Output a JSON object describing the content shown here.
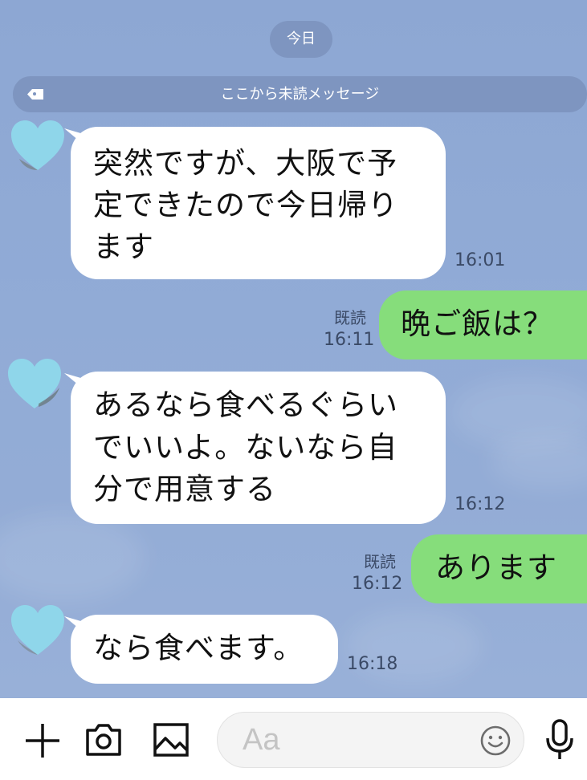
{
  "date_label": "今日",
  "unread_label": "ここから未読メッセージ",
  "messages": [
    {
      "dir": "in",
      "lines": [
        "突然ですが、大阪で予",
        "定できたので今日帰り",
        "ます"
      ],
      "time": "16:01"
    },
    {
      "dir": "out",
      "lines": [
        "晩ご飯は？"
      ],
      "read": "既読",
      "time": "16:11"
    },
    {
      "dir": "in",
      "lines": [
        "あるなら食べるぐらい",
        "でいいよ。ないなら自",
        "分で用意する"
      ],
      "time": "16:12"
    },
    {
      "dir": "out",
      "lines": [
        "あります"
      ],
      "read": "既読",
      "time": "16:12"
    },
    {
      "dir": "in",
      "lines": [
        "なら食べます。"
      ],
      "time": "16:18"
    }
  ],
  "input": {
    "placeholder": "Aa"
  },
  "icons": {
    "plus": "plus-icon",
    "camera": "camera-icon",
    "image": "image-icon",
    "emoji": "emoji-icon",
    "mic": "microphone-icon",
    "avatar": "heart-avatar"
  },
  "colors": {
    "background": "#8fa9d4",
    "incoming_bubble": "#ffffff",
    "outgoing_bubble": "#86dd7b",
    "avatar_heart": "#8fd6ea"
  }
}
